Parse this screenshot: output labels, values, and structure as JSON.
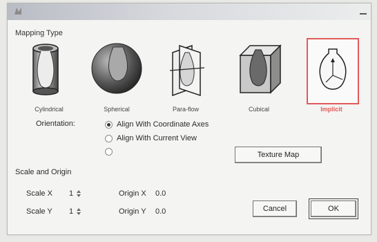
{
  "window": {
    "title": ""
  },
  "mapping": {
    "header": "Mapping Type",
    "types": [
      {
        "label": "Cylindrical",
        "icon": "cylindrical-map-icon"
      },
      {
        "label": "Spherical",
        "icon": "spherical-map-icon"
      },
      {
        "label": "Para-flow",
        "icon": "planar-map-icon"
      },
      {
        "label": "Cubical",
        "icon": "cubical-map-icon"
      },
      {
        "label": "Implicit",
        "icon": "implicit-map-icon",
        "selected": true
      }
    ],
    "highlight_color": "#e15a5a"
  },
  "orientation": {
    "label": "Orientation:",
    "options": [
      {
        "label": "Align With Coordinate Axes",
        "checked": true
      },
      {
        "label": "Align With Current View",
        "checked": false
      },
      {
        "label": "",
        "checked": false
      }
    ]
  },
  "texture_map_button": "Texture Map",
  "scale_origin": {
    "header": "Scale and Origin",
    "scale_x_label": "Scale X",
    "scale_x_value": "1",
    "scale_y_label": "Scale Y",
    "scale_y_value": "1",
    "origin_x_label": "Origin X",
    "origin_x_value": "0.0",
    "origin_y_label": "Origin Y",
    "origin_y_value": "0.0"
  },
  "buttons": {
    "cancel": "Cancel",
    "ok": "OK"
  }
}
